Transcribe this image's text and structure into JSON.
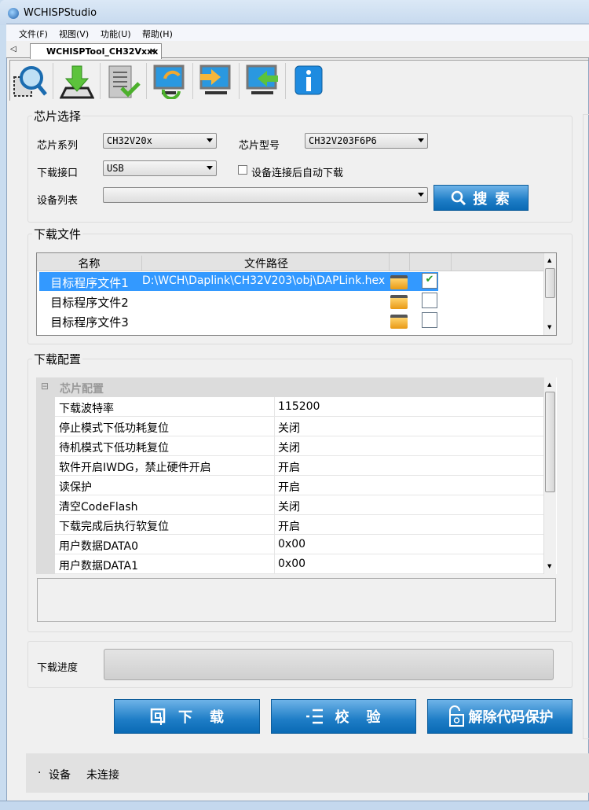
{
  "window": {
    "title": "WCHISPStudio"
  },
  "menu": [
    "文件(F)",
    "视图(V)",
    "功能(U)",
    "帮助(H)"
  ],
  "tab": {
    "label": "WCHISPTool_CH32Vxxx",
    "close": "×"
  },
  "toolbar": [
    "search-chip",
    "download",
    "verify",
    "refresh",
    "export",
    "import",
    "info"
  ],
  "chip_select": {
    "title": "芯片选择",
    "series_label": "芯片系列",
    "series_value": "CH32V20x",
    "model_label": "芯片型号",
    "model_value": "CH32V203F6P6",
    "port_label": "下载接口",
    "port_value": "USB",
    "auto_download_label": "设备连接后自动下载",
    "auto_download_checked": false,
    "device_list_label": "设备列表",
    "device_list_value": "",
    "search_button": "搜 索"
  },
  "download_file": {
    "title": "下载文件",
    "columns": [
      "名称",
      "文件路径"
    ],
    "rows": [
      {
        "name": "目标程序文件1",
        "path": "D:\\WCH\\Daplink\\CH32V203\\obj\\DAPLink.hex",
        "checked": true,
        "selected": true
      },
      {
        "name": "目标程序文件2",
        "path": "",
        "checked": false
      },
      {
        "name": "目标程序文件3",
        "path": "",
        "checked": false
      }
    ]
  },
  "download_config": {
    "title": "下载配置",
    "category": "芯片配置",
    "expander": "⊟",
    "rows": [
      {
        "key": "下载波特率",
        "value": "115200"
      },
      {
        "key": "停止模式下低功耗复位",
        "value": "关闭"
      },
      {
        "key": "待机模式下低功耗复位",
        "value": "关闭"
      },
      {
        "key": "软件开启IWDG，禁止硬件开启",
        "value": "开启"
      },
      {
        "key": "读保护",
        "value": "开启"
      },
      {
        "key": "清空CodeFlash",
        "value": "关闭"
      },
      {
        "key": "下载完成后执行软复位",
        "value": "开启"
      },
      {
        "key": "用户数据DATA0",
        "value": "0x00"
      },
      {
        "key": "用户数据DATA1",
        "value": "0x00"
      }
    ]
  },
  "progress": {
    "label": "下载进度",
    "value": 0
  },
  "buttons": {
    "download": "下　载",
    "verify": "校　验",
    "unprotect": "解除代码保护"
  },
  "status": {
    "bullet": "·",
    "device_label": "设备",
    "device_state": "未连接"
  }
}
